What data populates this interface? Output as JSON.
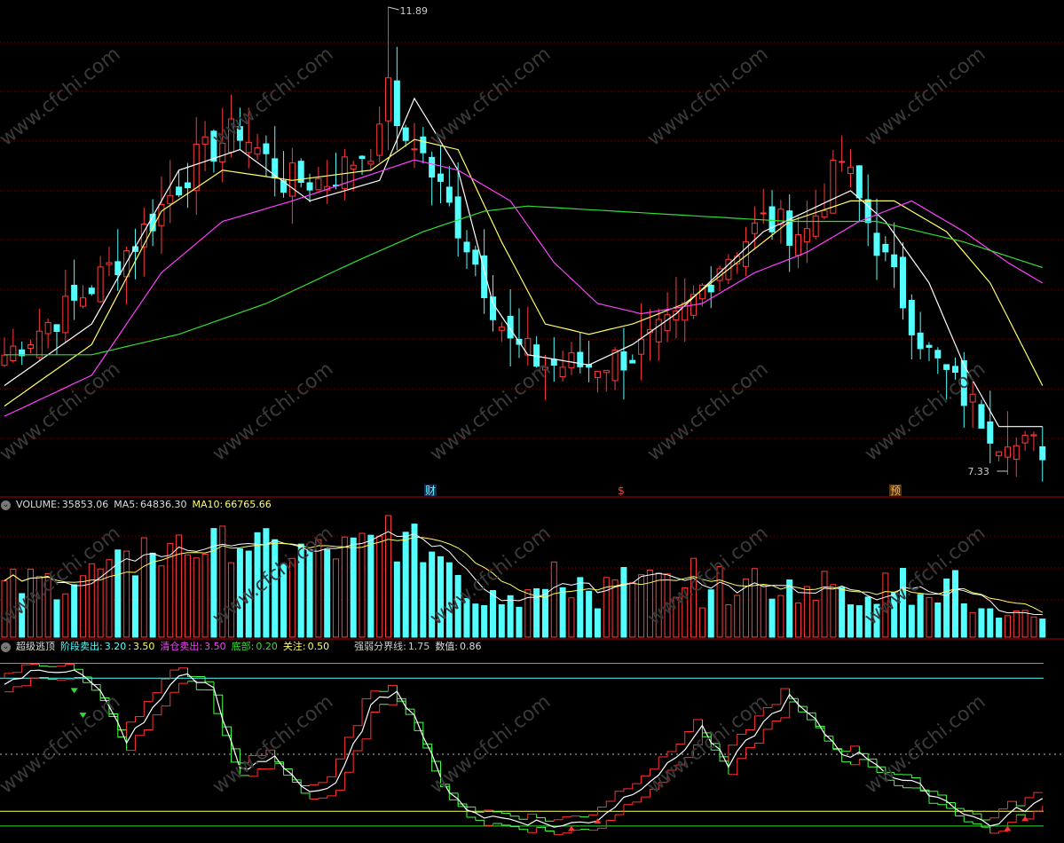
{
  "legend_volume": {
    "title": "VOLUME:",
    "value": "35853.06",
    "ma5_label": "MA5:",
    "ma5_value": "64836.30",
    "ma10_label": "MA10:",
    "ma10_value": "66765.66"
  },
  "legend_indicator": {
    "name": "超级逃顶",
    "stage_sell_label": "阶段卖出:",
    "stage_sell_v1": "3.20",
    "stage_sell_v2": "3.50",
    "clear_sell_label": "清仓卖出:",
    "clear_sell_value": "3.50",
    "bottom_label": "底部:",
    "bottom_value": "0.20",
    "watch_label": "关注:",
    "watch_value": "0.50",
    "strong_weak_label": "强弱分界线:",
    "strong_weak_value": "1.75",
    "value_label": "数值:",
    "value_value": "0.86"
  },
  "watermark": "www.cfchi.com",
  "colors": {
    "up": "#ff3a3a",
    "down": "#54ffff",
    "ma_white": "#ffffff",
    "ma_yellow": "#ffff66",
    "ma_magenta": "#ff40ff",
    "ma_green": "#33dd33",
    "grid": "#8b0000",
    "line_magenta": "#ff40ff",
    "line_cyan": "#54ffff",
    "line_yellow": "#ffff66",
    "line_green": "#33dd33"
  },
  "chart_data": [
    {
      "type": "candlestick",
      "series": [
        {
          "name": "price",
          "close_curve": [
            [
              0,
              8.5
            ],
            [
              8,
              9.0
            ],
            [
              15,
              9.6
            ],
            [
              22,
              10.4
            ],
            [
              27,
              10.7
            ],
            [
              32,
              10.2
            ],
            [
              37,
              10.2
            ],
            [
              43,
              10.6
            ],
            [
              47,
              10.6
            ],
            [
              53,
              9.6
            ],
            [
              58,
              8.6
            ],
            [
              62,
              8.4
            ],
            [
              67,
              8.4
            ],
            [
              72,
              8.5
            ],
            [
              77,
              8.8
            ],
            [
              82,
              9.4
            ],
            [
              87,
              9.8
            ],
            [
              92,
              9.7
            ],
            [
              96,
              10.4
            ],
            [
              101,
              9.4
            ],
            [
              106,
              8.5
            ],
            [
              110,
              8.1
            ],
            [
              115,
              7.6
            ],
            [
              119,
              7.6
            ]
          ]
        },
        {
          "name": "ma_white",
          "curve": [
            [
              0,
              8.2
            ],
            [
              10,
              8.8
            ],
            [
              20,
              10.3
            ],
            [
              27,
              10.5
            ],
            [
              35,
              10.0
            ],
            [
              43,
              10.2
            ],
            [
              47,
              11.0
            ],
            [
              52,
              10.3
            ],
            [
              56,
              9.0
            ],
            [
              60,
              8.5
            ],
            [
              67,
              8.4
            ],
            [
              72,
              8.6
            ],
            [
              77,
              8.9
            ],
            [
              82,
              9.3
            ],
            [
              87,
              9.7
            ],
            [
              92,
              9.9
            ],
            [
              97,
              10.1
            ],
            [
              101,
              9.8
            ],
            [
              106,
              9.2
            ],
            [
              110,
              8.4
            ],
            [
              114,
              7.8
            ],
            [
              119,
              7.8
            ]
          ]
        },
        {
          "name": "ma_yellow",
          "curve": [
            [
              0,
              8.0
            ],
            [
              10,
              8.6
            ],
            [
              18,
              9.9
            ],
            [
              25,
              10.3
            ],
            [
              33,
              10.2
            ],
            [
              42,
              10.3
            ],
            [
              47,
              10.6
            ],
            [
              52,
              10.5
            ],
            [
              57,
              9.6
            ],
            [
              62,
              8.8
            ],
            [
              67,
              8.7
            ],
            [
              72,
              8.8
            ],
            [
              78,
              9.0
            ],
            [
              84,
              9.4
            ],
            [
              90,
              9.8
            ],
            [
              97,
              10.0
            ],
            [
              102,
              10.0
            ],
            [
              108,
              9.7
            ],
            [
              113,
              9.2
            ],
            [
              119,
              8.2
            ]
          ]
        },
        {
          "name": "ma_magenta",
          "curve": [
            [
              0,
              7.9
            ],
            [
              10,
              8.3
            ],
            [
              18,
              9.3
            ],
            [
              25,
              9.8
            ],
            [
              33,
              10.0
            ],
            [
              40,
              10.2
            ],
            [
              47,
              10.4
            ],
            [
              52,
              10.3
            ],
            [
              58,
              10.0
            ],
            [
              63,
              9.4
            ],
            [
              68,
              9.0
            ],
            [
              73,
              8.9
            ],
            [
              80,
              9.0
            ],
            [
              86,
              9.3
            ],
            [
              92,
              9.5
            ],
            [
              98,
              9.8
            ],
            [
              104,
              10.0
            ],
            [
              110,
              9.7
            ],
            [
              115,
              9.4
            ],
            [
              119,
              9.2
            ]
          ]
        },
        {
          "name": "ma_green",
          "curve": [
            [
              0,
              8.5
            ],
            [
              10,
              8.5
            ],
            [
              20,
              8.7
            ],
            [
              30,
              9.0
            ],
            [
              40,
              9.4
            ],
            [
              48,
              9.7
            ],
            [
              55,
              9.9
            ],
            [
              60,
              9.95
            ],
            [
              70,
              9.9
            ],
            [
              80,
              9.85
            ],
            [
              90,
              9.8
            ],
            [
              100,
              9.8
            ],
            [
              110,
              9.6
            ],
            [
              119,
              9.35
            ]
          ]
        }
      ],
      "annotations": [
        "11.89",
        "7.33",
        "财",
        "$",
        "预"
      ],
      "high_label": "11.89",
      "low_label": "7.33"
    },
    {
      "type": "bar",
      "series": [
        {
          "name": "VOLUME",
          "last_value": 35853.06
        },
        {
          "name": "MA5",
          "last_value": 64836.3
        },
        {
          "name": "MA10",
          "last_value": 66765.66
        }
      ]
    },
    {
      "type": "line",
      "series": [
        {
          "name": "数值",
          "last_value": 0.86,
          "curve": [
            [
              0,
              3.1
            ],
            [
              4,
              3.35
            ],
            [
              8,
              3.4
            ],
            [
              11,
              2.9
            ],
            [
              14,
              1.95
            ],
            [
              16,
              2.3
            ],
            [
              20,
              3.3
            ],
            [
              24,
              3.0
            ],
            [
              27,
              1.3
            ],
            [
              31,
              1.6
            ],
            [
              35,
              0.9
            ],
            [
              38,
              1.0
            ],
            [
              42,
              2.6
            ],
            [
              45,
              3.0
            ],
            [
              48,
              2.1
            ],
            [
              51,
              0.8
            ],
            [
              55,
              0.4
            ],
            [
              60,
              0.3
            ],
            [
              64,
              0.2
            ],
            [
              68,
              0.35
            ],
            [
              72,
              0.9
            ],
            [
              76,
              1.4
            ],
            [
              80,
              2.2
            ],
            [
              83,
              1.4
            ],
            [
              86,
              2.1
            ],
            [
              90,
              2.8
            ],
            [
              93,
              2.3
            ],
            [
              96,
              1.7
            ],
            [
              99,
              1.6
            ],
            [
              102,
              1.2
            ],
            [
              106,
              0.9
            ],
            [
              110,
              0.5
            ],
            [
              113,
              0.2
            ],
            [
              116,
              0.5
            ],
            [
              119,
              0.7
            ]
          ]
        }
      ],
      "levels": [
        {
          "label": "阶段卖出",
          "value": 3.2
        },
        {
          "label": "清仓卖出",
          "value": 3.5
        },
        {
          "label": "底部",
          "value": 0.2
        },
        {
          "label": "关注",
          "value": 0.5
        },
        {
          "label": "强弱分界线",
          "value": 1.75
        }
      ]
    }
  ]
}
